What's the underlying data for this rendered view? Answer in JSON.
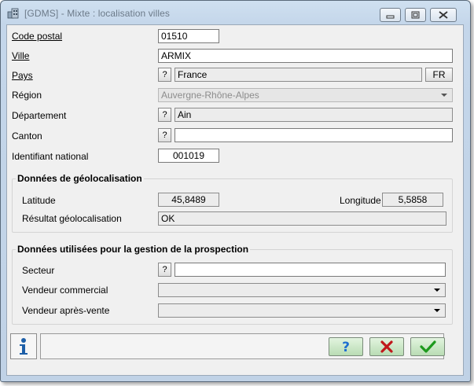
{
  "window": {
    "title": "[GDMS] - Mixte : localisation villes"
  },
  "form": {
    "code_postal": {
      "label": "Code postal",
      "value": "01510"
    },
    "ville": {
      "label": "Ville",
      "value": "ARMIX"
    },
    "pays": {
      "label": "Pays",
      "help": "?",
      "value": "France",
      "code_button": "FR"
    },
    "region": {
      "label": "Région",
      "value": "Auvergne-Rhône-Alpes"
    },
    "departement": {
      "label": "Département",
      "help": "?",
      "value": "Ain"
    },
    "canton": {
      "label": "Canton",
      "help": "?",
      "value": ""
    },
    "identifiant": {
      "label": "Identifiant national",
      "value": "001019"
    }
  },
  "geo": {
    "title": "Données de géolocalisation",
    "latitude_label": "Latitude",
    "latitude_value": "45,8489",
    "longitude_label": "Longitude",
    "longitude_value": "5,5858",
    "result_label": "Résultat géolocalisation",
    "result_value": "OK"
  },
  "prospection": {
    "title": "Données utilisées pour la gestion de la prospection",
    "secteur_label": "Secteur",
    "secteur_help": "?",
    "secteur_value": "",
    "vendeur_commercial_label": "Vendeur commercial",
    "vendeur_commercial_value": "",
    "vendeur_apres_vente_label": "Vendeur après-vente",
    "vendeur_apres_vente_value": ""
  },
  "icons": {
    "app": "app-building-icon",
    "info": "info-icon",
    "help": "help-question-icon",
    "cancel": "cancel-x-icon",
    "ok": "ok-check-icon"
  },
  "colors": {
    "help_blue": "#1f6fd0",
    "cancel_red": "#c0181b",
    "ok_green": "#1e9a1e",
    "action_button_bg": "#c8e6c2"
  }
}
